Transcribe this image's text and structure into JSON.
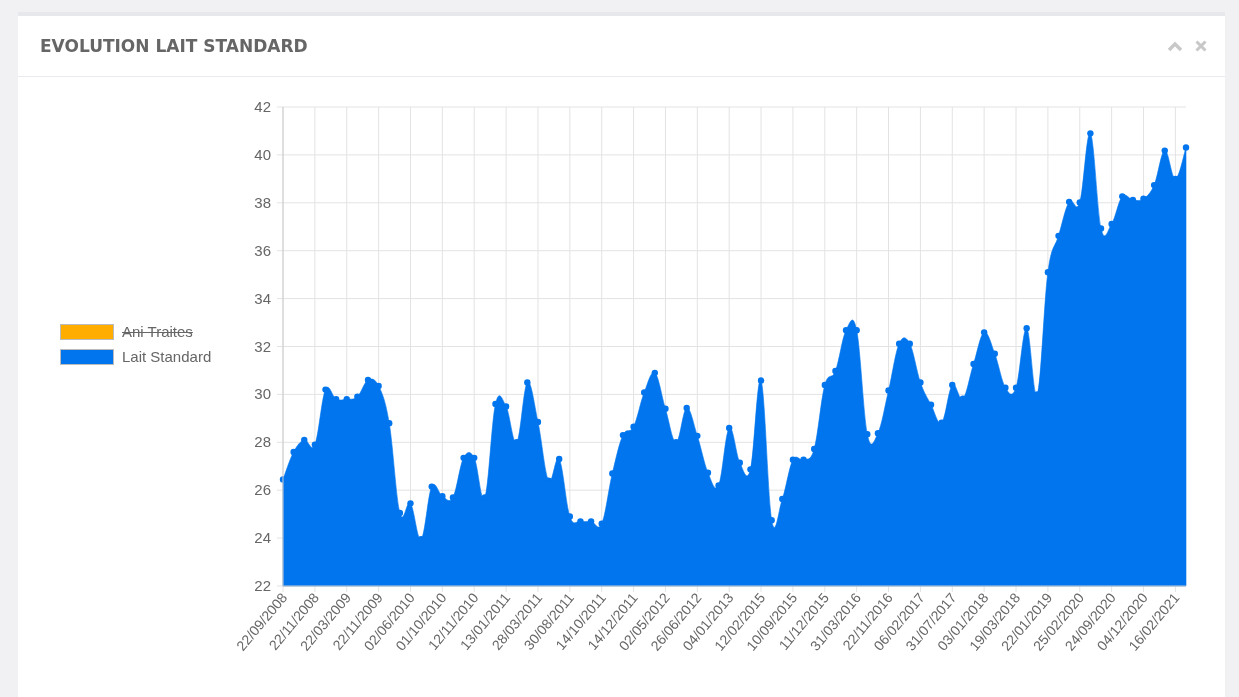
{
  "panel": {
    "title": "EVOLUTION LAIT STANDARD"
  },
  "legend": [
    {
      "label": "Ani Traites",
      "color": "#ffad00",
      "hidden": true
    },
    {
      "label": "Lait Standard",
      "color": "#0075ee",
      "hidden": false
    }
  ],
  "chart_data": {
    "type": "area",
    "categories": [
      "22/09/2008",
      null,
      null,
      "22/11/2008",
      null,
      null,
      "22/03/2009",
      null,
      null,
      "22/11/2009",
      null,
      null,
      "02/06/2010",
      null,
      null,
      "01/10/2010",
      null,
      null,
      "12/11/2010",
      null,
      null,
      "13/01/2011",
      null,
      null,
      "28/03/2011",
      null,
      null,
      "30/08/2011",
      null,
      null,
      "14/10/2011",
      null,
      null,
      "14/12/2011",
      null,
      null,
      "02/05/2012",
      null,
      null,
      "26/06/2012",
      null,
      null,
      "04/01/2013",
      null,
      null,
      "12/02/2015",
      null,
      null,
      "10/09/2015",
      null,
      null,
      "11/12/2015",
      null,
      null,
      "31/03/2016",
      null,
      null,
      "22/11/2016",
      null,
      null,
      "06/02/2017",
      null,
      null,
      "31/07/2017",
      null,
      null,
      "03/01/2018",
      null,
      null,
      "19/03/2018",
      null,
      null,
      "22/01/2019",
      null,
      null,
      "25/02/2020",
      null,
      null,
      "24/09/2020",
      null,
      null,
      "04/12/2020",
      null,
      null,
      "16/02/2021",
      null
    ],
    "series": [
      {
        "color": "#0075ee",
        "values": [
          26.45,
          27.6,
          28.1,
          27.9,
          30.2,
          29.8,
          29.8,
          29.9,
          30.6,
          30.35,
          28.8,
          25.05,
          25.45,
          23.95,
          26.15,
          25.75,
          25.7,
          27.35,
          27.35,
          25.7,
          29.6,
          29.5,
          28.0,
          30.5,
          28.85,
          26.4,
          27.3,
          24.9,
          24.7,
          24.7,
          24.6,
          26.7,
          28.3,
          28.65,
          30.08,
          30.9,
          29.4,
          28.0,
          29.43,
          28.27,
          26.73,
          26.2,
          28.6,
          27.15,
          26.87,
          30.58,
          24.75,
          25.63,
          27.27,
          27.27,
          27.72,
          30.39,
          30.98,
          32.68,
          32.68,
          28.34,
          28.38,
          30.16,
          32.12,
          32.12,
          30.5,
          29.57,
          28.82,
          30.39,
          29.82,
          31.27,
          32.59,
          31.7,
          30.28,
          30.28,
          32.76,
          30.0,
          35.1,
          36.62,
          38.04,
          38.01,
          40.9,
          36.93,
          37.12,
          38.27,
          38.12,
          38.17,
          38.74,
          40.18,
          39.0,
          40.31
        ]
      }
    ],
    "grid": true,
    "ylim": [
      22,
      42
    ],
    "yticks": [
      22,
      24,
      26,
      28,
      30,
      32,
      34,
      36,
      38,
      40,
      42
    ]
  }
}
